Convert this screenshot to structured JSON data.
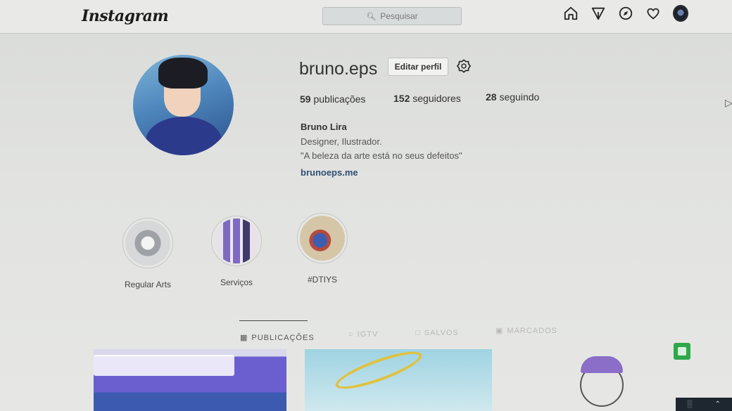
{
  "topbar": {
    "logo": "Instagram",
    "search_placeholder": "Pesquisar",
    "nav_icons": [
      "home-icon",
      "direct-icon",
      "explore-icon",
      "heart-icon",
      "profile-avatar"
    ]
  },
  "profile": {
    "username": "bruno.eps",
    "edit_button": "Editar perfil",
    "stats": {
      "posts_count": "59",
      "posts_label": "publicações",
      "followers_count": "152",
      "followers_label": "seguidores",
      "following_count": "28",
      "following_label": "seguindo"
    },
    "full_name": "Bruno Lira",
    "bio_line1": "Designer, Ilustrador.",
    "bio_line2": "\"A beleza da arte está no seus defeitos\"",
    "link": "brunoeps.me"
  },
  "highlights": [
    {
      "label": "Regular Arts"
    },
    {
      "label": "Serviços"
    },
    {
      "label": "#DTIYS"
    }
  ],
  "tabs": {
    "publicacoes": "PUBLICAÇÕES",
    "igtv": "IGTV",
    "salvos": "SALVOS",
    "marcados": "MARCADOS"
  },
  "colors": {
    "background": "#e3e4e1",
    "link": "#2e4f74",
    "accent_green": "#2ea84a"
  }
}
